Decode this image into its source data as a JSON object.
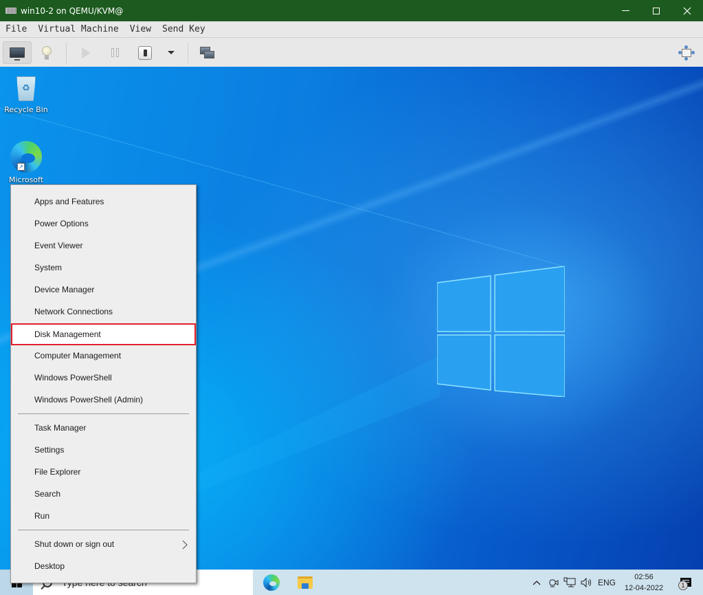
{
  "window": {
    "title": "win10-2 on QEMU/KVM@",
    "controls": {
      "minimize": "minimize",
      "maximize": "maximize",
      "close": "close"
    },
    "accent_color": "#1d5a1f"
  },
  "menubar": {
    "items": [
      "File",
      "Virtual Machine",
      "View",
      "Send Key"
    ]
  },
  "toolbar": {
    "buttons": [
      {
        "name": "console",
        "icon": "monitor-icon",
        "active": true
      },
      {
        "name": "details",
        "icon": "lightbulb-icon"
      },
      {
        "name": "run",
        "icon": "play-icon",
        "disabled": true
      },
      {
        "name": "pause",
        "icon": "pause-icon",
        "disabled": true
      },
      {
        "name": "shutdown",
        "icon": "power-icon"
      },
      {
        "name": "shutdown-menu",
        "icon": "dropdown-caret-icon"
      },
      {
        "name": "snapshots",
        "icon": "screens-icon"
      },
      {
        "name": "fullscreen",
        "icon": "fullscreen-icon"
      }
    ]
  },
  "desktop": {
    "icons": [
      {
        "label": "Recycle Bin",
        "icon": "recycle-bin-icon"
      },
      {
        "label": "Microsoft",
        "icon": "edge-icon"
      }
    ]
  },
  "context_menu": {
    "groups": [
      [
        "Apps and Features",
        "Power Options",
        "Event Viewer",
        "System",
        "Device Manager",
        "Network Connections",
        "Disk Management",
        "Computer Management",
        "Windows PowerShell",
        "Windows PowerShell (Admin)"
      ],
      [
        "Task Manager",
        "Settings",
        "File Explorer",
        "Search",
        "Run"
      ],
      [
        "Shut down or sign out",
        "Desktop"
      ]
    ],
    "highlighted": "Disk Management",
    "highlight_color": "#e2202c",
    "submenu_item": "Shut down or sign out"
  },
  "taskbar": {
    "search_placeholder": "Type here to search",
    "pinned": [
      "Microsoft Edge",
      "File Explorer"
    ],
    "tray": {
      "chevron": "^",
      "language": "ENG",
      "time": "02:56",
      "date": "12-04-2022",
      "notification_count": "1"
    }
  }
}
